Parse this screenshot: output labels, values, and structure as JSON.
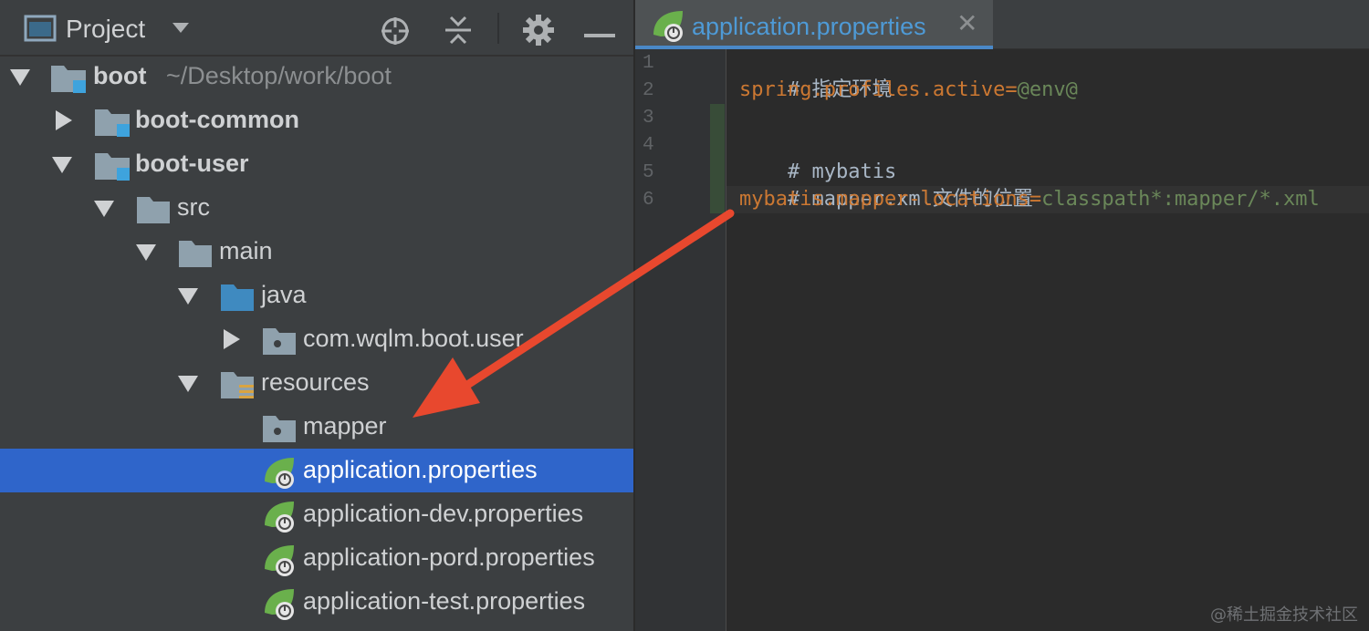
{
  "project_panel": {
    "title": "Project",
    "header_icons": [
      "window-icon",
      "chevron-down-icon",
      "locate-icon",
      "collapse-all-icon",
      "gear-icon",
      "minimize-icon"
    ],
    "tree": [
      {
        "label": "boot",
        "suffix": "~/Desktop/work/boot",
        "bold": true,
        "expanded": true,
        "icon": "module-folder-icon"
      },
      {
        "label": "boot-common",
        "bold": true,
        "expanded": false,
        "icon": "module-folder-icon"
      },
      {
        "label": "boot-user",
        "bold": true,
        "expanded": true,
        "icon": "module-folder-icon"
      },
      {
        "label": "src",
        "expanded": true,
        "icon": "folder-icon"
      },
      {
        "label": "main",
        "expanded": true,
        "icon": "folder-icon"
      },
      {
        "label": "java",
        "expanded": true,
        "icon": "source-folder-icon"
      },
      {
        "label": "com.wqlm.boot.user",
        "expanded": false,
        "icon": "package-icon"
      },
      {
        "label": "resources",
        "expanded": true,
        "icon": "resources-folder-icon"
      },
      {
        "label": "mapper",
        "icon": "package-icon"
      },
      {
        "label": "application.properties",
        "icon": "spring-properties-icon",
        "selected": true
      },
      {
        "label": "application-dev.properties",
        "icon": "spring-properties-icon"
      },
      {
        "label": "application-pord.properties",
        "icon": "spring-properties-icon"
      },
      {
        "label": "application-test.properties",
        "icon": "spring-properties-icon"
      }
    ]
  },
  "editor": {
    "active_tab": "application.properties",
    "close_glyph": "✕",
    "lines": [
      {
        "no": "1",
        "comment": "# 指定环境"
      },
      {
        "no": "2",
        "key": "spring.profiles.active",
        "eq": "=",
        "value": "@env@"
      },
      {
        "no": "3"
      },
      {
        "no": "4",
        "comment": "# mybatis"
      },
      {
        "no": "5",
        "comment": "# mapper.xml文件的位置"
      },
      {
        "no": "6",
        "key": "mybatis.mapper-locations",
        "eq": "=",
        "value": "classpath*:mapper/*.xml"
      }
    ]
  },
  "colors": {
    "selection": "#2f65ca",
    "annotation_arrow": "#e8482e",
    "property_key": "#cc7832",
    "property_value": "#6a8759"
  },
  "watermark": "@稀土掘金技术社区"
}
